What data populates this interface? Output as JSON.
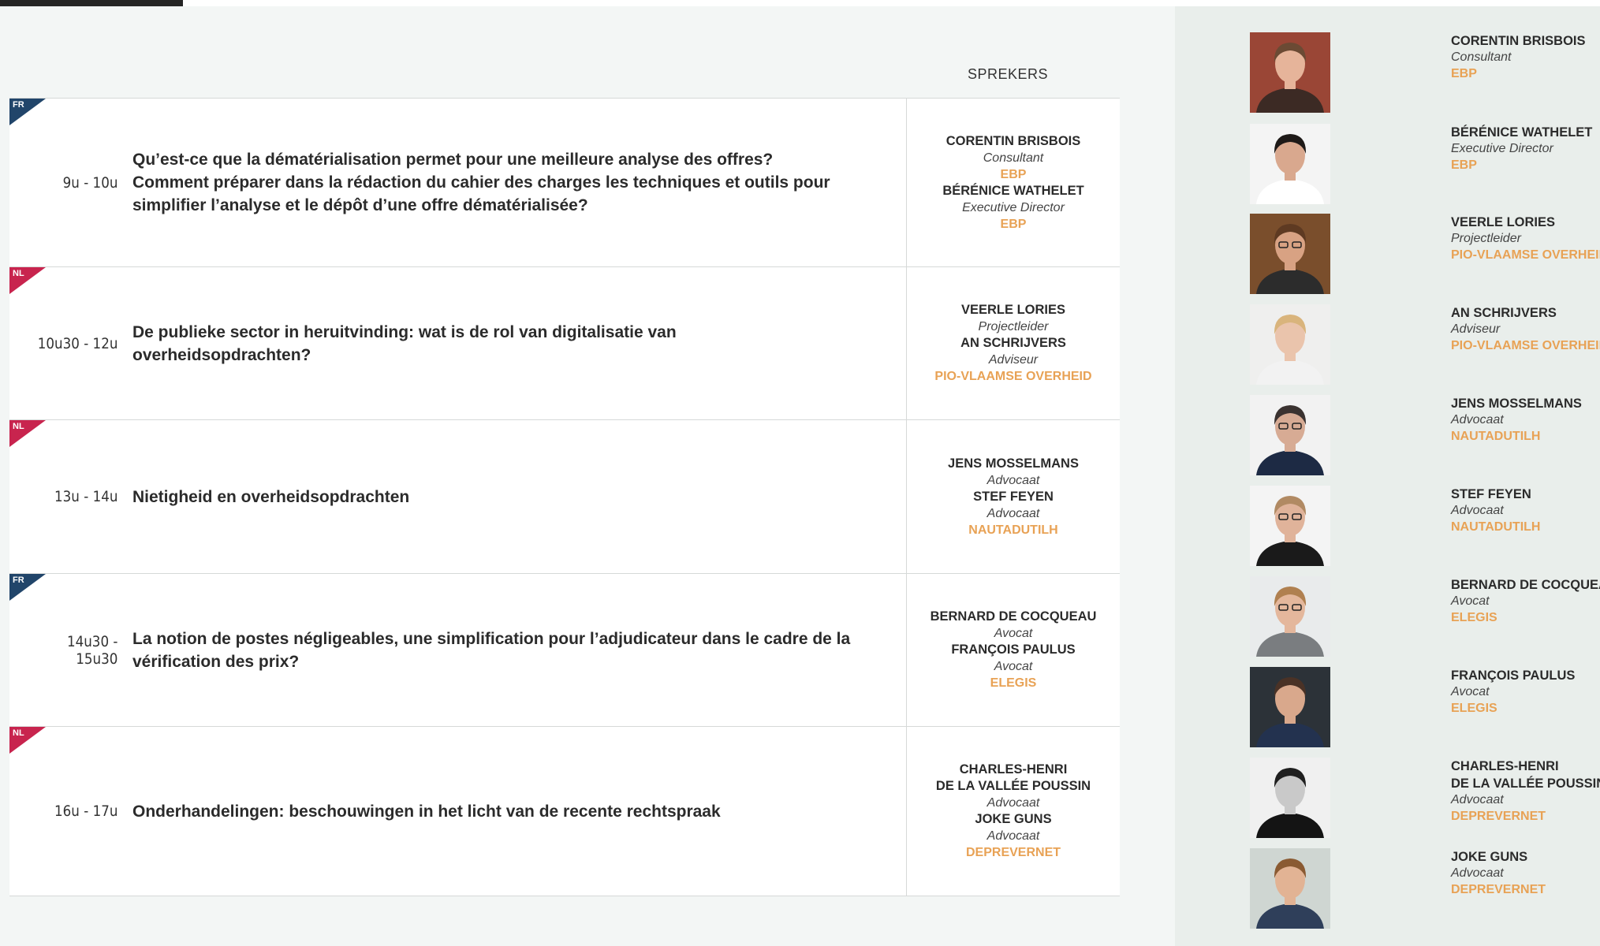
{
  "colors": {
    "fr_tag": "#21456a",
    "nl_tag": "#c8244e",
    "org": "#e8a255",
    "text": "#2b2b2b"
  },
  "header": {
    "sprekers": "SPREKERS"
  },
  "sessions": [
    {
      "lang": "FR",
      "time": "9u - 10u",
      "title_lines": [
        "Qu’est-ce que la dématérialisation permet pour une meilleure analyse des offres?",
        "Comment préparer dans la rédaction du cahier des charges les techniques et outils pour",
        "simplifier l’analyse et le dépôt d’une offre dématérialisée?"
      ],
      "speakers": [
        {
          "kind": "name",
          "text": "CORENTIN BRISBOIS"
        },
        {
          "kind": "role",
          "text": "Consultant"
        },
        {
          "kind": "org",
          "text": "EBP"
        },
        {
          "kind": "name",
          "text": "BÉRÉNICE WATHELET"
        },
        {
          "kind": "role",
          "text": "Executive Director"
        },
        {
          "kind": "org",
          "text": "EBP"
        }
      ]
    },
    {
      "lang": "NL",
      "time": "10u30 - 12u",
      "title_lines": [
        "De publieke sector in heruitvinding: wat is de rol van digitalisatie van",
        "overheidsopdrachten?"
      ],
      "speakers": [
        {
          "kind": "name",
          "text": "VEERLE LORIES"
        },
        {
          "kind": "role",
          "text": "Projectleider"
        },
        {
          "kind": "name",
          "text": "AN SCHRIJVERS"
        },
        {
          "kind": "role",
          "text": "Adviseur"
        },
        {
          "kind": "org",
          "text": "PIO-VLAAMSE OVERHEID"
        }
      ]
    },
    {
      "lang": "NL",
      "time": "13u - 14u",
      "title_lines": [
        "Nietigheid en overheidsopdrachten"
      ],
      "speakers": [
        {
          "kind": "name",
          "text": "JENS MOSSELMANS"
        },
        {
          "kind": "role",
          "text": "Advocaat"
        },
        {
          "kind": "name",
          "text": "STEF FEYEN"
        },
        {
          "kind": "role",
          "text": "Advocaat"
        },
        {
          "kind": "org",
          "text": "NAUTADUTILH"
        }
      ]
    },
    {
      "lang": "FR",
      "time": "14u30 - 15u30",
      "title_lines": [
        "La notion de postes négligeables, une simplification pour l’adjudicateur dans le cadre de la",
        "vérification des prix?"
      ],
      "speakers": [
        {
          "kind": "name",
          "text": "BERNARD DE COCQUEAU"
        },
        {
          "kind": "role",
          "text": "Avocat"
        },
        {
          "kind": "name",
          "text": "FRANÇOIS PAULUS"
        },
        {
          "kind": "role",
          "text": "Avocat"
        },
        {
          "kind": "org",
          "text": "ELEGIS"
        }
      ]
    },
    {
      "lang": "NL",
      "time": "16u - 17u",
      "title_lines": [
        "Onderhandelingen: beschouwingen in het licht van de recente rechtspraak"
      ],
      "speakers": [
        {
          "kind": "name",
          "text": "CHARLES-HENRI"
        },
        {
          "kind": "name",
          "text": "DE LA VALLÉE POUSSIN"
        },
        {
          "kind": "role",
          "text": "Advocaat"
        },
        {
          "kind": "name",
          "text": "JOKE GUNS"
        },
        {
          "kind": "role",
          "text": "Advocaat"
        },
        {
          "kind": "org",
          "text": "DEPREVERNET"
        }
      ]
    }
  ],
  "people": [
    {
      "name_lines": [
        "CORENTIN BRISBOIS"
      ],
      "role": "Consultant",
      "org": "EBP",
      "photo": "man-red-background"
    },
    {
      "name_lines": [
        "BÉRÉNICE WATHELET"
      ],
      "role": "Executive Director",
      "org": "EBP",
      "photo": "woman-white-background"
    },
    {
      "name_lines": [
        "VEERLE LORIES"
      ],
      "role": "Projectleider",
      "org": "PIO-VLAAMSE OVERHEID",
      "photo": "woman-glasses"
    },
    {
      "name_lines": [
        "AN SCHRIJVERS"
      ],
      "role": "Adviseur",
      "org": "PIO-VLAAMSE OVERHEID",
      "photo": "woman-blonde"
    },
    {
      "name_lines": [
        "JENS MOSSELMANS"
      ],
      "role": "Advocaat",
      "org": "NAUTADUTILH",
      "photo": "man-suit-glasses"
    },
    {
      "name_lines": [
        "STEF FEYEN"
      ],
      "role": "Advocaat",
      "org": "NAUTADUTILH",
      "photo": "man-suit"
    },
    {
      "name_lines": [
        "BERNARD DE COCQUEAU"
      ],
      "role": "Avocat",
      "org": "ELEGIS",
      "photo": "man-grey-jacket"
    },
    {
      "name_lines": [
        "FRANÇOIS PAULUS"
      ],
      "role": "Avocat",
      "org": "ELEGIS",
      "photo": "man-dark-background"
    },
    {
      "name_lines": [
        "CHARLES-HENRI",
        "DE LA VALLÉE POUSSIN"
      ],
      "role": "Advocaat",
      "org": "DEPREVERNET",
      "photo": "man-black-white"
    },
    {
      "name_lines": [
        "JOKE GUNS"
      ],
      "role": "Advocaat",
      "org": "DEPREVERNET",
      "photo": "woman-brown-hair"
    }
  ]
}
